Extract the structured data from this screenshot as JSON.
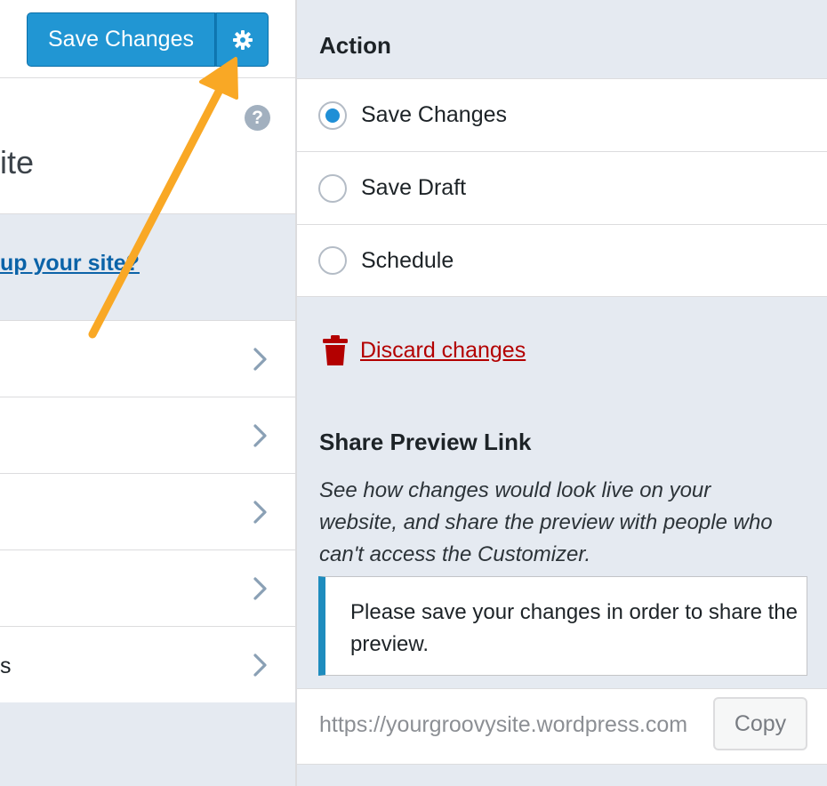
{
  "header": {
    "save_button_label": "Save Changes"
  },
  "site_panel": {
    "title_fragment": "ite",
    "help_symbol": "?",
    "setup_link_fragment": "up your site?"
  },
  "menu_rows": [
    {
      "label_fragment": ""
    },
    {
      "label_fragment": ""
    },
    {
      "label_fragment": ""
    },
    {
      "label_fragment": ""
    },
    {
      "label_fragment": "s"
    }
  ],
  "publish_settings": {
    "action_heading": "Action",
    "options": [
      {
        "label": "Save Changes",
        "selected": true
      },
      {
        "label": "Save Draft",
        "selected": false
      },
      {
        "label": "Schedule",
        "selected": false
      }
    ],
    "discard_label": "Discard changes",
    "share_heading": "Share Preview Link",
    "share_description": "See how changes would look live on your website, and share the preview with people who can't access the Customizer.",
    "notice_text": "Please save your changes in order to share the preview.",
    "preview_url": "https://yourgroovysite.wordpress.com",
    "copy_label": "Copy"
  },
  "colors": {
    "primary_button": "#2196d3",
    "annotation_arrow": "#f9a825",
    "discard": "#b30000",
    "link": "#0b63a8"
  },
  "icons": {
    "settings": "gear-icon",
    "help": "help-icon",
    "chevron": "chevron-right-icon",
    "discard": "trash-icon"
  }
}
